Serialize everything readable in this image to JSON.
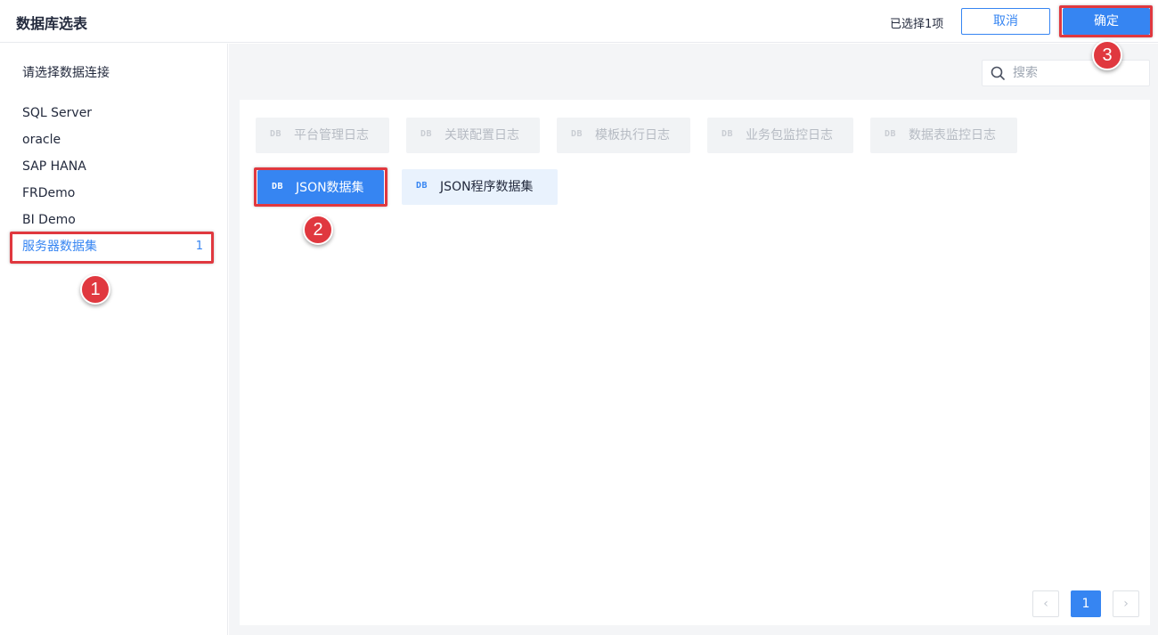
{
  "header": {
    "title": "数据库选表",
    "selected_count": "已选择1项",
    "cancel_label": "取消",
    "confirm_label": "确定"
  },
  "sidebar": {
    "title": "请选择数据连接",
    "connections": [
      {
        "label": "SQL Server"
      },
      {
        "label": "oracle"
      },
      {
        "label": "SAP HANA"
      },
      {
        "label": "FRDemo"
      },
      {
        "label": "BI Demo"
      },
      {
        "label": "服务器数据集",
        "count": "1",
        "active": true
      }
    ]
  },
  "search": {
    "placeholder": "搜索",
    "icon": "search-icon"
  },
  "tables": {
    "icon_text": "DB",
    "row1": [
      {
        "label": "平台管理日志",
        "state": "disabled"
      },
      {
        "label": "关联配置日志",
        "state": "disabled"
      },
      {
        "label": "模板执行日志",
        "state": "disabled"
      },
      {
        "label": "业务包监控日志",
        "state": "disabled"
      },
      {
        "label": "数据表监控日志",
        "state": "disabled"
      }
    ],
    "row2": [
      {
        "label": "JSON数据集",
        "state": "selected"
      },
      {
        "label": "JSON程序数据集",
        "state": "normal"
      }
    ]
  },
  "pagination": {
    "prev": "‹",
    "current": "1",
    "next": "›"
  },
  "annotations": {
    "step1": "1",
    "step2": "2",
    "step3": "3"
  },
  "colors": {
    "accent": "#3685f2",
    "highlight": "#e0383f"
  }
}
